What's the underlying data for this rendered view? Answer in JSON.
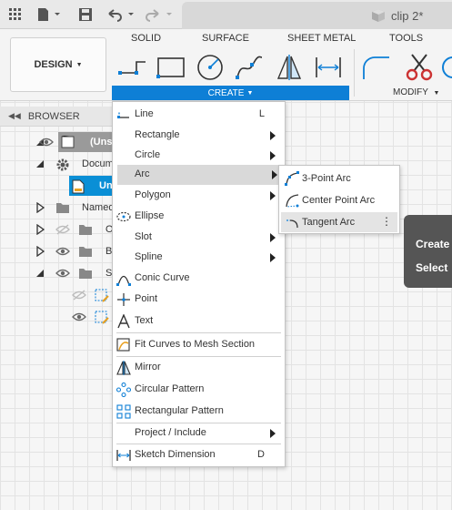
{
  "titlebar": {
    "doc_title": "clip 2*"
  },
  "toolbar": {
    "workspace_label": "DESIGN",
    "tabs": [
      "SOLID",
      "SURFACE",
      "SHEET METAL",
      "TOOLS"
    ],
    "create_label": "CREATE",
    "modify_label": "MODIFY"
  },
  "browser": {
    "header_label": "BROWSER",
    "rows": [
      {
        "label": "(Uns"
      },
      {
        "label": "Docum"
      },
      {
        "label": "Un"
      },
      {
        "label": "Named"
      },
      {
        "label": "O"
      },
      {
        "label": "B"
      },
      {
        "label": "S"
      }
    ]
  },
  "create_menu": {
    "items": [
      {
        "label": "Line",
        "shortcut": "L",
        "icon": "line-icon"
      },
      {
        "label": "Rectangle",
        "icon": "none"
      },
      {
        "label": "Circle",
        "icon": "none"
      },
      {
        "label": "Arc",
        "icon": "none"
      },
      {
        "label": "Polygon",
        "icon": "none"
      },
      {
        "label": "Ellipse",
        "icon": "ellipse-icon"
      },
      {
        "label": "Slot",
        "icon": "none"
      },
      {
        "label": "Spline",
        "icon": "none"
      },
      {
        "label": "Conic Curve",
        "icon": "conic-curve-icon"
      },
      {
        "label": "Point",
        "icon": "point-icon"
      },
      {
        "label": "Text",
        "icon": "text-icon"
      },
      {
        "label": "Fit Curves to Mesh Section",
        "icon": "fit-curves-icon"
      },
      {
        "label": "Mirror",
        "icon": "mirror-icon"
      },
      {
        "label": "Circular Pattern",
        "icon": "circular-pattern-icon"
      },
      {
        "label": "Rectangular Pattern",
        "icon": "rectangular-pattern-icon"
      },
      {
        "label": "Project / Include",
        "icon": "none"
      },
      {
        "label": "Sketch Dimension",
        "shortcut": "D",
        "icon": "sketch-dimension-icon"
      }
    ]
  },
  "arc_submenu": {
    "items": [
      {
        "label": "3-Point Arc"
      },
      {
        "label": "Center Point Arc"
      },
      {
        "label": "Tangent Arc"
      }
    ],
    "more_glyph": "⋮"
  },
  "tooltip": {
    "line1": "Create",
    "line2": "Select"
  },
  "colors": {
    "accent": "#0e7fd6",
    "selection": "#0a8fd6",
    "tooltip_bg": "#555555"
  }
}
